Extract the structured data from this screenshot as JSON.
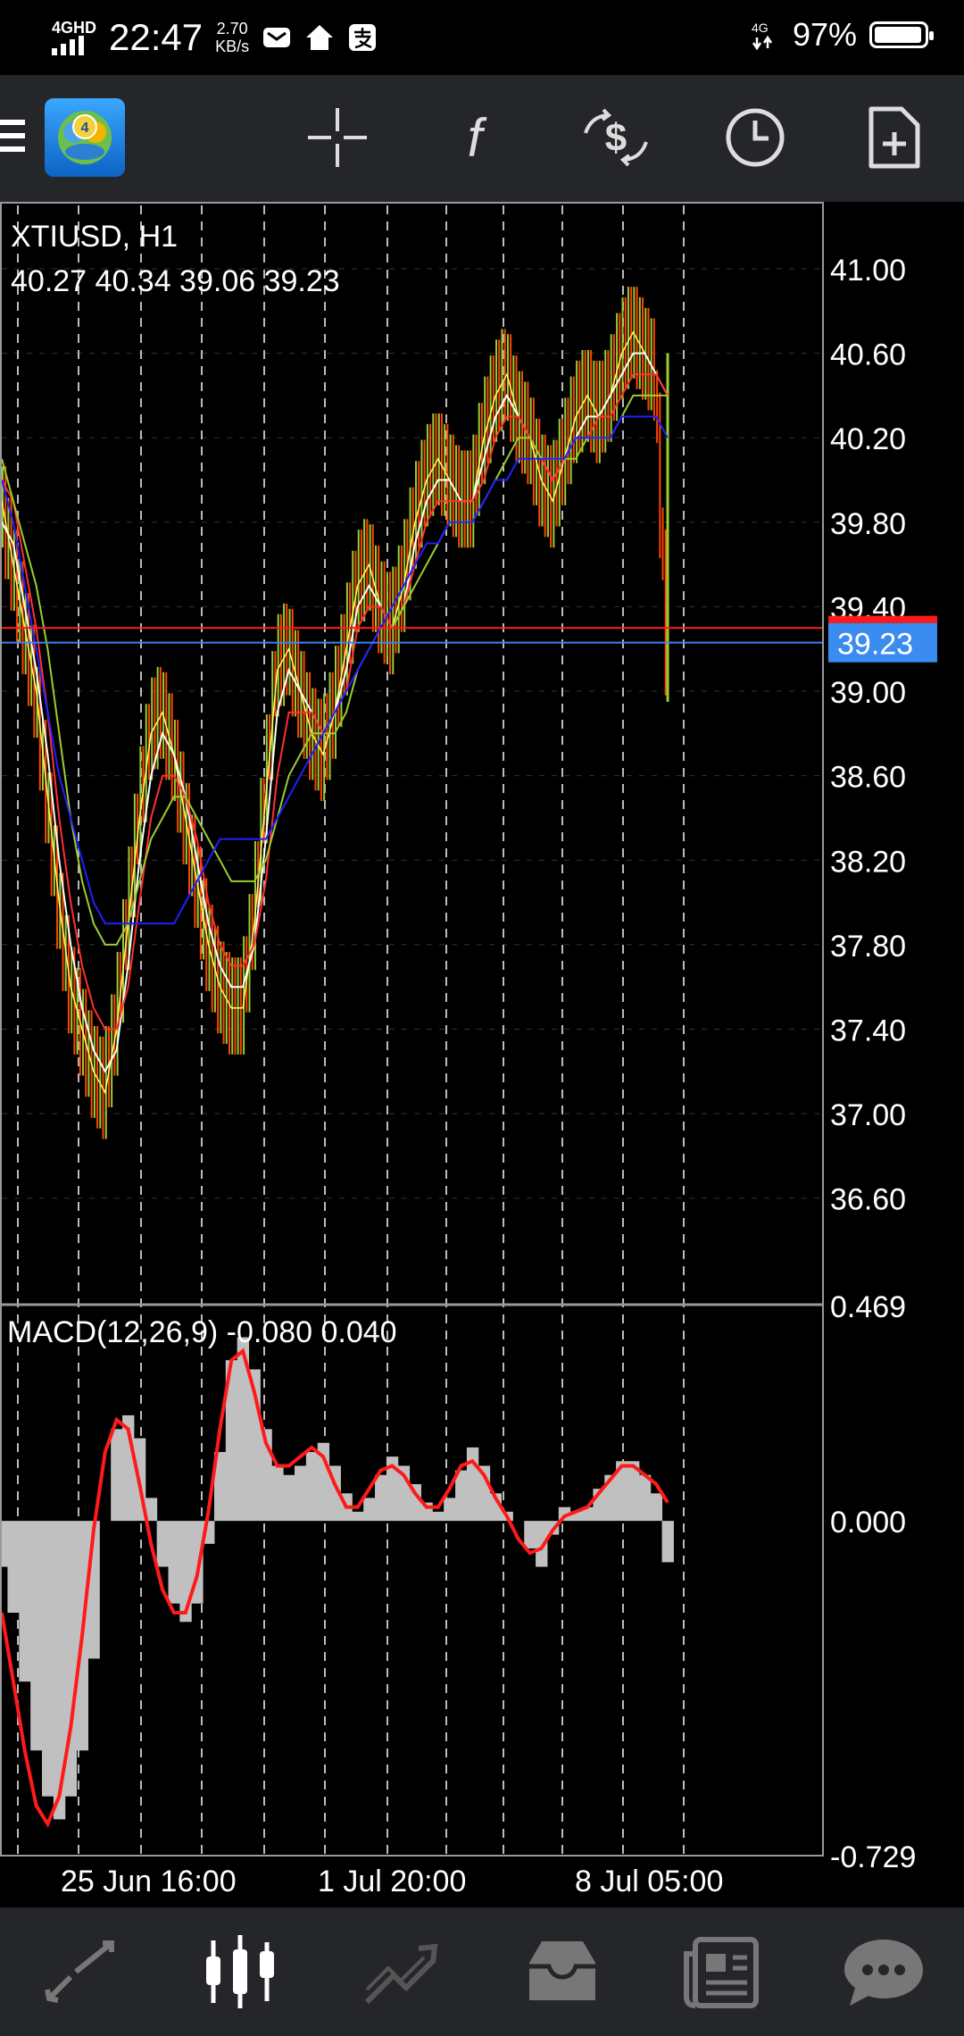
{
  "status_bar": {
    "network_label": "4GHD",
    "time": "22:47",
    "speed_value": "2.70",
    "speed_unit": "KB/s",
    "right_network": "4G",
    "battery": "97%",
    "icons": [
      "mail-icon",
      "home-icon",
      "alipay-icon"
    ]
  },
  "toolbar": {
    "app_icon": "metatrader4-logo",
    "app_badge": "4",
    "buttons": [
      {
        "name": "crosshair-icon"
      },
      {
        "name": "indicators-icon",
        "label": "f"
      },
      {
        "name": "trade-icon"
      },
      {
        "name": "timeframe-clock-icon"
      },
      {
        "name": "new-order-icon"
      }
    ]
  },
  "chart": {
    "symbol": "XTIUSD, H1",
    "ohlc": "40.27 40.34 39.06 39.23",
    "price_ticks": [
      "41.00",
      "40.60",
      "40.20",
      "39.80",
      "39.40",
      "39.00",
      "38.60",
      "38.20",
      "37.80",
      "37.40",
      "37.00",
      "36.60"
    ],
    "price_values": [
      41.0,
      40.6,
      40.2,
      39.8,
      39.4,
      39.0,
      38.6,
      38.2,
      37.8,
      37.4,
      37.0,
      36.6
    ],
    "current_price": "39.23",
    "bid_line_value": 39.23,
    "ask_line_value": 39.3,
    "colors": {
      "up": "#9acd32",
      "down": "#ff4500",
      "ask": "#ff1a1a",
      "bid": "#3b82f6",
      "macd_signal": "#ff1a1a",
      "macd_hist": "#c0c0c0",
      "ma_white": "#ffffff",
      "ma_yellow": "#ffff66",
      "ma_red": "#ff3030",
      "ma_green": "#9acd32",
      "ma_blue": "#2020ff"
    },
    "time_labels": [
      "25 Jun 16:00",
      "1 Jul 20:00",
      "8 Jul 05:00"
    ]
  },
  "chart_data": {
    "type": "line",
    "title": "XTIUSD, H1",
    "xlabel": "",
    "ylabel": "",
    "ylim": [
      36.1,
      41.3
    ],
    "x_ticks": [
      "25 Jun 16:00",
      "1 Jul 20:00",
      "8 Jul 05:00"
    ],
    "series": [
      {
        "values": [
          39.9,
          39.6,
          39.3,
          39.0,
          38.5,
          38.0,
          37.6,
          37.4,
          37.2,
          37.1,
          37.4,
          37.9,
          38.4,
          38.8,
          38.9,
          38.7,
          38.4,
          38.1,
          37.8,
          37.6,
          37.5,
          37.5,
          37.9,
          38.5,
          39.1,
          39.2,
          39.0,
          38.8,
          38.7,
          38.9,
          39.2,
          39.5,
          39.6,
          39.4,
          39.3,
          39.5,
          39.8,
          40.0,
          40.1,
          40.0,
          39.9,
          39.9,
          40.2,
          40.4,
          40.5,
          40.3,
          40.2,
          40.0,
          39.9,
          40.1,
          40.3,
          40.4,
          40.3,
          40.4,
          40.6,
          40.7,
          40.6,
          40.5,
          39.2
        ]
      },
      {
        "values": [
          39.8,
          39.7,
          39.4,
          39.1,
          38.7,
          38.2,
          37.8,
          37.5,
          37.3,
          37.2,
          37.3,
          37.7,
          38.2,
          38.6,
          38.8,
          38.7,
          38.5,
          38.2,
          37.9,
          37.7,
          37.6,
          37.6,
          37.8,
          38.3,
          38.9,
          39.1,
          39.0,
          38.9,
          38.8,
          38.9,
          39.1,
          39.4,
          39.5,
          39.4,
          39.3,
          39.4,
          39.7,
          39.9,
          40.0,
          40.0,
          39.9,
          39.9,
          40.1,
          40.3,
          40.4,
          40.3,
          40.2,
          40.1,
          40.0,
          40.1,
          40.2,
          40.3,
          40.3,
          40.4,
          40.5,
          40.6,
          40.6,
          40.5,
          40.4
        ]
      },
      {
        "values": [
          40.0,
          39.9,
          39.6,
          39.3,
          38.9,
          38.4,
          38.0,
          37.7,
          37.5,
          37.4,
          37.4,
          37.6,
          38.0,
          38.4,
          38.6,
          38.6,
          38.5,
          38.3,
          38.0,
          37.8,
          37.7,
          37.7,
          37.8,
          38.1,
          38.6,
          38.9,
          38.9,
          38.9,
          38.8,
          38.9,
          39.0,
          39.3,
          39.4,
          39.4,
          39.3,
          39.4,
          39.6,
          39.8,
          39.9,
          39.9,
          39.9,
          39.9,
          40.0,
          40.2,
          40.3,
          40.3,
          40.2,
          40.1,
          40.0,
          40.1,
          40.2,
          40.2,
          40.3,
          40.3,
          40.4,
          40.5,
          40.5,
          40.5,
          40.4
        ]
      },
      {
        "values": [
          40.1,
          39.9,
          39.7,
          39.5,
          39.2,
          38.8,
          38.4,
          38.1,
          37.9,
          37.8,
          37.8,
          37.9,
          38.1,
          38.3,
          38.4,
          38.5,
          38.5,
          38.4,
          38.3,
          38.2,
          38.1,
          38.1,
          38.1,
          38.2,
          38.4,
          38.6,
          38.7,
          38.8,
          38.8,
          38.8,
          38.9,
          39.1,
          39.2,
          39.3,
          39.3,
          39.4,
          39.5,
          39.6,
          39.7,
          39.8,
          39.8,
          39.8,
          39.9,
          40.0,
          40.1,
          40.2,
          40.2,
          40.1,
          40.1,
          40.1,
          40.1,
          40.2,
          40.2,
          40.2,
          40.3,
          40.4,
          40.4,
          40.4,
          40.4
        ]
      },
      {
        "values": [
          40.0,
          39.8,
          39.5,
          39.2,
          38.9,
          38.6,
          38.4,
          38.2,
          38.0,
          37.9,
          37.9,
          37.9,
          37.9,
          37.9,
          37.9,
          37.9,
          38.0,
          38.1,
          38.2,
          38.3,
          38.3,
          38.3,
          38.3,
          38.3,
          38.4,
          38.5,
          38.6,
          38.7,
          38.8,
          38.9,
          39.0,
          39.1,
          39.2,
          39.3,
          39.4,
          39.5,
          39.6,
          39.7,
          39.7,
          39.8,
          39.8,
          39.8,
          39.9,
          40.0,
          40.0,
          40.1,
          40.1,
          40.1,
          40.1,
          40.1,
          40.2,
          40.2,
          40.2,
          40.2,
          40.3,
          40.3,
          40.3,
          40.3,
          40.2
        ]
      }
    ]
  },
  "macd": {
    "label": "MACD(12,26,9)  -0.080 0.040",
    "ticks": [
      "0.469",
      "0.000",
      "-0.729"
    ],
    "tick_values": [
      0.469,
      0.0,
      -0.729
    ],
    "ylim": [
      -0.729,
      0.469
    ],
    "histogram": [
      -0.1,
      -0.2,
      -0.35,
      -0.5,
      -0.6,
      -0.65,
      -0.6,
      -0.5,
      -0.3,
      0.0,
      0.2,
      0.23,
      0.18,
      0.05,
      -0.1,
      -0.18,
      -0.22,
      -0.18,
      -0.05,
      0.15,
      0.35,
      0.4,
      0.33,
      0.2,
      0.12,
      0.1,
      0.12,
      0.15,
      0.17,
      0.12,
      0.06,
      0.02,
      0.05,
      0.1,
      0.14,
      0.12,
      0.08,
      0.04,
      0.02,
      0.05,
      0.11,
      0.16,
      0.12,
      0.06,
      0.02,
      0.0,
      -0.06,
      -0.1,
      -0.03,
      0.03,
      0.02,
      0.03,
      0.07,
      0.1,
      0.13,
      0.13,
      0.1,
      0.06,
      -0.09
    ],
    "signal": [
      -0.2,
      -0.35,
      -0.5,
      -0.62,
      -0.66,
      -0.6,
      -0.45,
      -0.25,
      -0.02,
      0.15,
      0.22,
      0.2,
      0.08,
      -0.05,
      -0.15,
      -0.2,
      -0.2,
      -0.12,
      0.02,
      0.2,
      0.35,
      0.37,
      0.28,
      0.17,
      0.12,
      0.12,
      0.14,
      0.16,
      0.14,
      0.08,
      0.03,
      0.03,
      0.07,
      0.11,
      0.12,
      0.1,
      0.06,
      0.03,
      0.03,
      0.07,
      0.12,
      0.13,
      0.1,
      0.05,
      0.01,
      -0.04,
      -0.07,
      -0.06,
      -0.02,
      0.01,
      0.02,
      0.03,
      0.06,
      0.09,
      0.12,
      0.12,
      0.1,
      0.08,
      0.04
    ]
  },
  "bottom_nav": [
    {
      "name": "nav-quotes-icon"
    },
    {
      "name": "nav-chart-icon",
      "active": true
    },
    {
      "name": "nav-trade-icon"
    },
    {
      "name": "nav-history-icon"
    },
    {
      "name": "nav-news-icon"
    },
    {
      "name": "nav-chat-icon"
    }
  ]
}
